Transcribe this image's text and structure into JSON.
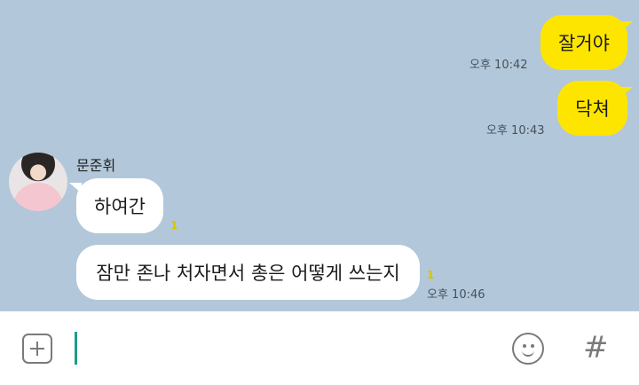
{
  "chat": {
    "sent": [
      {
        "text": "잘거야",
        "time": "오후 10:42"
      },
      {
        "text": "닥쳐",
        "time": "오후 10:43"
      }
    ],
    "sender_name": "문준휘",
    "received": [
      {
        "text": "하여간",
        "unread": "1"
      },
      {
        "text": "잠만 존나 처자면서 총은 어떻게 쓰는지",
        "unread": "1",
        "time": "오후 10:46"
      }
    ]
  },
  "input": {
    "value": "",
    "add_icon": "plus-square-icon",
    "emoji_icon": "smiley-icon",
    "hash_label": "#"
  },
  "colors": {
    "background": "#b2c7d9",
    "my_bubble": "#fee500",
    "their_bubble": "#ffffff",
    "cursor": "#1e9c8c"
  }
}
